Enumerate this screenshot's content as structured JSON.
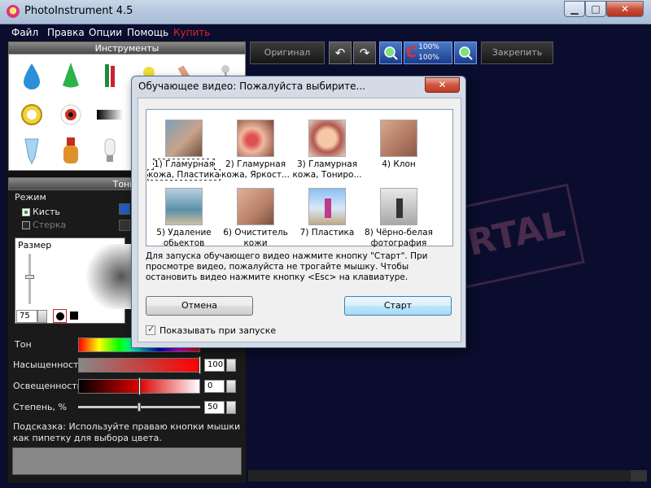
{
  "window": {
    "title": "PhotoInstrument 4.5",
    "min_glyph": "▁",
    "max_glyph": "□",
    "close_glyph": "✕"
  },
  "menu": [
    "Файл",
    "Правка",
    "Опции",
    "Помощь",
    "Купить"
  ],
  "toolbar": {
    "original_label": "Оригинал",
    "zoom_top": "100%",
    "zoom_bottom": "100%",
    "fix_label": "Закрепить",
    "undo_glyph": "↶",
    "redo_glyph": "↷"
  },
  "tools_panel": {
    "title": "Инструменты"
  },
  "tone_panel": {
    "title": "Тонир",
    "mode_label": "Режим",
    "brush_label": "Кисть",
    "eraser_label": "Стерка",
    "size_label": "Размер",
    "size_value": "75",
    "hue_label": "Тон",
    "saturation_label": "Насыщенность",
    "saturation_value": "100",
    "lightness_label": "Освещенность",
    "lightness_value": "0",
    "degree_label": "Степень, %",
    "degree_value": "50",
    "hint": "Подсказка: Используйте праваю кнопки мышки как пипетку для выбора цвета."
  },
  "watermark": "RTAL",
  "dialog": {
    "title": "Обучающее видео: Пожалуйста выбирите...",
    "close_glyph": "✕",
    "videos": [
      {
        "caption": "1) Гламурная кожа, Пластика"
      },
      {
        "caption": "2) Гламурная кожа, Яркост..."
      },
      {
        "caption": "3) Гламурная кожа, Тониро..."
      },
      {
        "caption": "4) Клон"
      },
      {
        "caption": "5) Удаление обьектов"
      },
      {
        "caption": "6) Очиститель кожи"
      },
      {
        "caption": "7) Пластика"
      },
      {
        "caption": "8) Чёрно-белая фотография"
      }
    ],
    "info": "Для запуска обучающего видео нажмите кнопку \"Старт\". При просмотре видео, пожалуйста не трогайте мышку. Чтобы остановить видео нажмите кнопку <Esc> на клавиатуре.",
    "cancel_label": "Отмена",
    "start_label": "Старт",
    "show_on_start_label": "Показывать при запуске",
    "show_on_start_checked": true
  }
}
